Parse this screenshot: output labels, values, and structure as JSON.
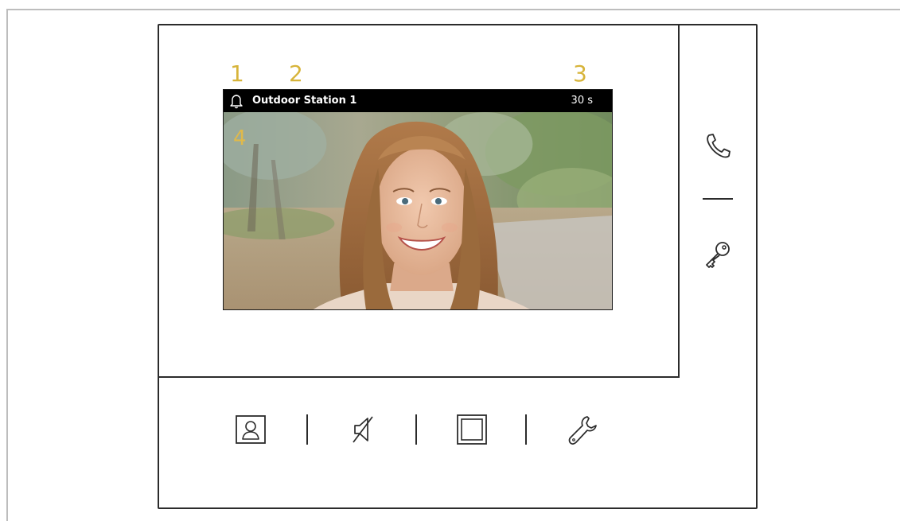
{
  "callouts": [
    "1",
    "2",
    "3",
    "4"
  ],
  "status_bar": {
    "station_name": "Outdoor Station 1",
    "timer": "30 s"
  },
  "icons": {
    "status": "bell-icon",
    "side": [
      "phone-icon",
      "key-icon"
    ],
    "bottom": [
      "contact-card-icon",
      "mute-icon",
      "screen-frame-icon",
      "wrench-icon"
    ]
  },
  "colors": {
    "callout": "#d7b43a",
    "device_outline": "#2b2b2b",
    "status_bar_bg": "#000000"
  }
}
